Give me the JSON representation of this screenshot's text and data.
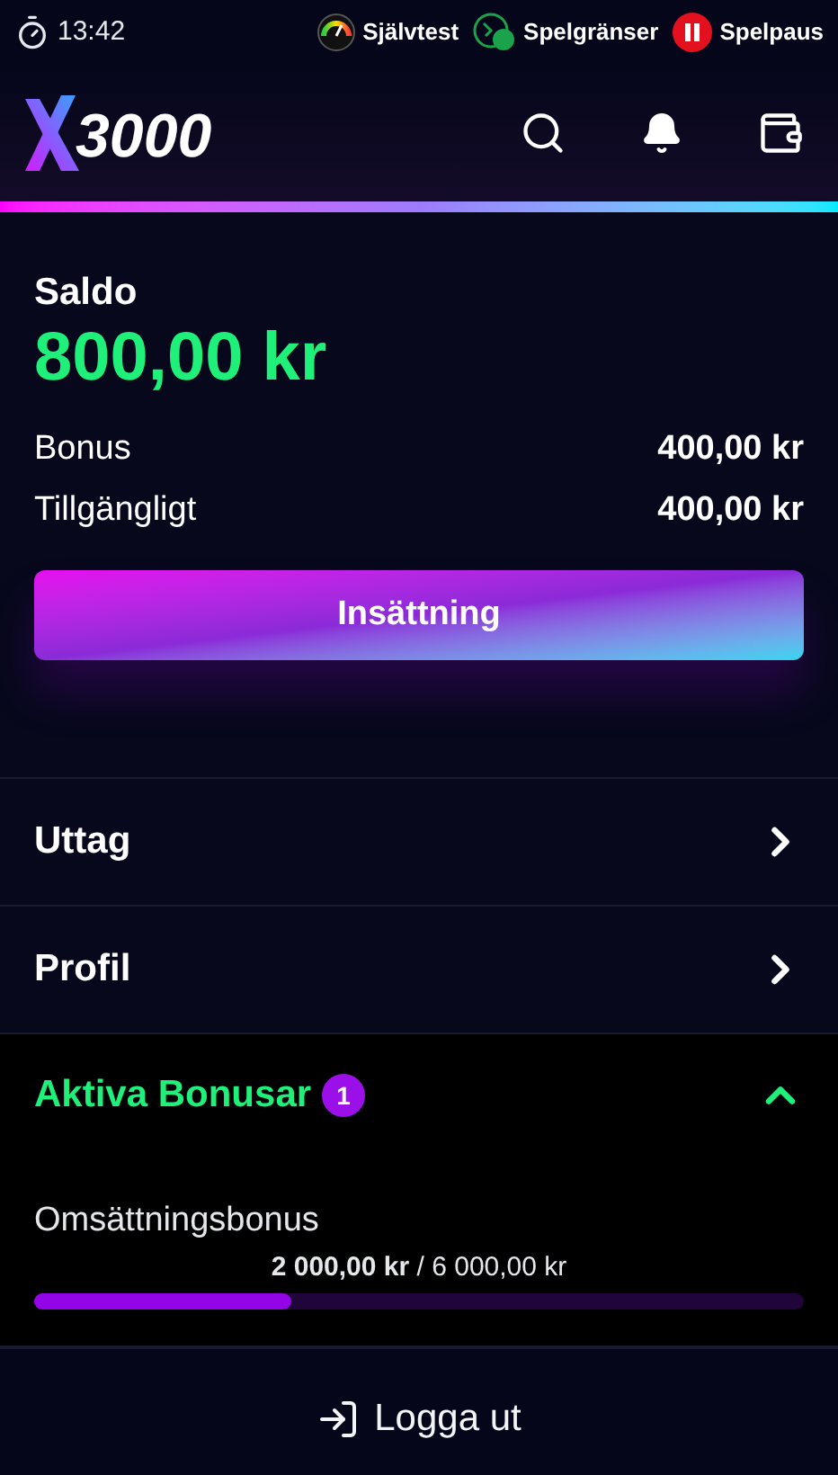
{
  "status_bar": {
    "time": "13:42",
    "links": [
      {
        "kind": "gauge",
        "label": "Självtest"
      },
      {
        "kind": "limits",
        "label": "Spelgränser"
      },
      {
        "kind": "pause",
        "label": "Spelpaus"
      }
    ]
  },
  "header": {
    "logo": "3000"
  },
  "balance": {
    "title": "Saldo",
    "amount": "800,00 kr",
    "lines": [
      {
        "label": "Bonus",
        "value": "400,00 kr"
      },
      {
        "label": "Tillgängligt",
        "value": "400,00 kr"
      }
    ],
    "deposit_button": "Insättning"
  },
  "menu": [
    {
      "label": "Uttag"
    },
    {
      "label": "Profil"
    }
  ],
  "bonuses": {
    "title": "Aktiva Bonusar",
    "count": "1",
    "expanded": true,
    "items": [
      {
        "name": "Omsättningsbonus",
        "progress": "2 000,00 kr",
        "target": "/ 6 000,00 kr",
        "level": 0.333
      }
    ]
  },
  "logout": "Logga ut"
}
